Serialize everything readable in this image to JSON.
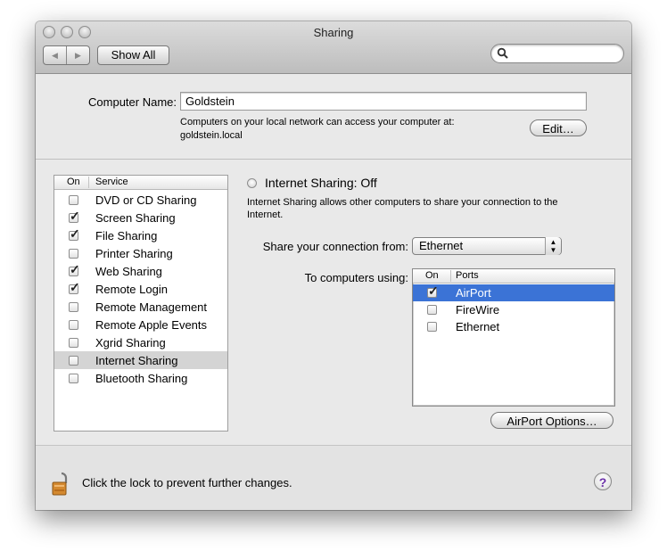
{
  "window": {
    "title": "Sharing"
  },
  "toolbar": {
    "back_icon": "◀",
    "forward_icon": "▶",
    "show_all_label": "Show All",
    "search_value": ""
  },
  "computer": {
    "name_label": "Computer Name:",
    "name_value": "Goldstein",
    "info_line1": "Computers on your local network can access your computer at:",
    "info_line2": "goldstein.local",
    "edit_label": "Edit…"
  },
  "services": {
    "header_on": "On",
    "header_service": "Service",
    "items": [
      {
        "label": "DVD or CD Sharing",
        "checked": false,
        "selected": false
      },
      {
        "label": "Screen Sharing",
        "checked": true,
        "selected": false
      },
      {
        "label": "File Sharing",
        "checked": true,
        "selected": false
      },
      {
        "label": "Printer Sharing",
        "checked": false,
        "selected": false
      },
      {
        "label": "Web Sharing",
        "checked": true,
        "selected": false
      },
      {
        "label": "Remote Login",
        "checked": true,
        "selected": false
      },
      {
        "label": "Remote Management",
        "checked": false,
        "selected": false
      },
      {
        "label": "Remote Apple Events",
        "checked": false,
        "selected": false
      },
      {
        "label": "Xgrid Sharing",
        "checked": false,
        "selected": false
      },
      {
        "label": "Internet Sharing",
        "checked": false,
        "selected": true
      },
      {
        "label": "Bluetooth Sharing",
        "checked": false,
        "selected": false
      }
    ]
  },
  "detail": {
    "status": "Internet Sharing: Off",
    "desc_line1": "Internet Sharing allows other computers to share your connection to the",
    "desc_line2": "Internet.",
    "share_from_label": "Share your connection from:",
    "share_from_value": "Ethernet",
    "to_computers_label": "To computers using:",
    "ports_header_on": "On",
    "ports_header_ports": "Ports",
    "ports": [
      {
        "label": "AirPort",
        "checked": true,
        "selected": true
      },
      {
        "label": "FireWire",
        "checked": false,
        "selected": false
      },
      {
        "label": "Ethernet",
        "checked": false,
        "selected": false
      }
    ],
    "airport_options_label": "AirPort Options…"
  },
  "footer": {
    "lock_text": "Click the lock to prevent further changes.",
    "help_label": "?"
  },
  "colors": {
    "selection_blue": "#3b73d6",
    "selected_row_gray": "#d4d4d4"
  },
  "icons": {
    "check": "✓"
  }
}
